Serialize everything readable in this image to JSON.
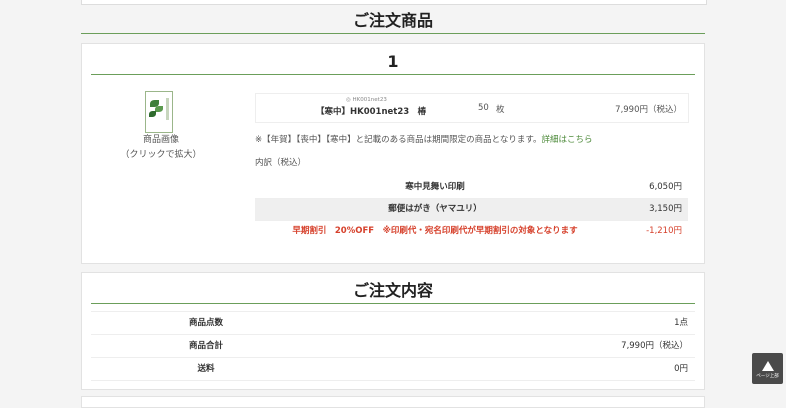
{
  "section_title": "ご注文商品",
  "item": {
    "index": "1",
    "image_caption_1": "商品画像",
    "image_caption_2": "（クリックで拡大）",
    "product_code": "◎ HK001net23",
    "product_name": "【寒中】HK001net23　椿",
    "quantity": "50",
    "quantity_unit": "枚",
    "price": "7,990円（税込）",
    "notice": "※【年賀】【喪中】【寒中】と記載のある商品は期間限定の商品となります。",
    "notice_link": "詳細はこちら",
    "breakdown_title": "内訳（税込）",
    "breakdown": [
      {
        "label": "寒中見舞い印刷",
        "value": "6,050円"
      },
      {
        "label": "郵便はがき（ヤマユリ）",
        "value": "3,150円"
      },
      {
        "label": "早期割引　20%OFF　※印刷代・宛名印刷代が早期割引の対象となります",
        "value": "-1,210円"
      }
    ]
  },
  "order_summary": {
    "title": "ご注文内容",
    "rows": [
      {
        "label": "商品点数",
        "value": "1点"
      },
      {
        "label": "商品合計",
        "value": "7,990円（税込）"
      },
      {
        "label": "送料",
        "value": "0円"
      }
    ]
  },
  "back_to_top": {
    "label": "ページ上部"
  },
  "colors": {
    "accent_green": "#6b9e5a",
    "discount_red": "#d6402b"
  }
}
